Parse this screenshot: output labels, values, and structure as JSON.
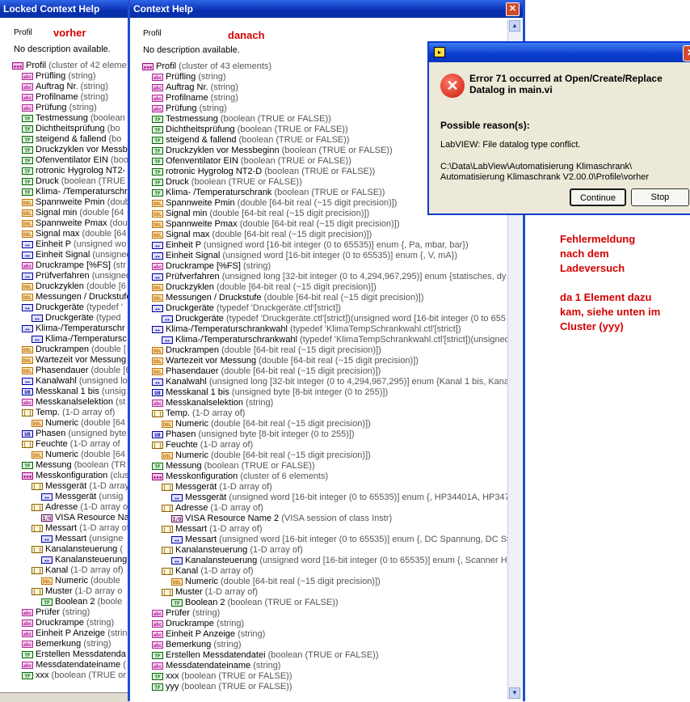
{
  "left": {
    "title": "Locked Context Help",
    "profil_label": "Profil",
    "annotation": "vorher",
    "no_desc": "No description available.",
    "rows": [
      {
        "d": 0,
        "ic": "cl",
        "n": "Profil",
        "t": "(cluster of 42 eleme"
      },
      {
        "d": 1,
        "ic": "str",
        "n": "Prüfling",
        "t": "(string)"
      },
      {
        "d": 1,
        "ic": "str",
        "n": "Auftrag Nr.",
        "t": "(string)"
      },
      {
        "d": 1,
        "ic": "str",
        "n": "Profilname",
        "t": "(string)"
      },
      {
        "d": 1,
        "ic": "str",
        "n": "Prüfung",
        "t": "(string)"
      },
      {
        "d": 1,
        "ic": "bool",
        "n": "Testmessung",
        "t": "(boolean"
      },
      {
        "d": 1,
        "ic": "bool",
        "n": "Dichtheitsprüfung",
        "t": "(bo"
      },
      {
        "d": 1,
        "ic": "bool",
        "n": "steigend & fallend",
        "t": "(bo"
      },
      {
        "d": 1,
        "ic": "bool",
        "n": "Druckzyklen vor Messb",
        "t": ""
      },
      {
        "d": 1,
        "ic": "bool",
        "n": "Ofenventilator EIN",
        "t": "(boo"
      },
      {
        "d": 1,
        "ic": "bool",
        "n": "rotronic Hygrolog NT2-",
        "t": ""
      },
      {
        "d": 1,
        "ic": "bool",
        "n": "Druck",
        "t": "(boolean (TRUE"
      },
      {
        "d": 1,
        "ic": "bool",
        "n": "Klima- /Temperaturschra",
        "t": ""
      },
      {
        "d": 1,
        "ic": "dbl",
        "n": "Spannweite Pmin",
        "t": "(double"
      },
      {
        "d": 1,
        "ic": "dbl",
        "n": "Signal min",
        "t": "(double [64"
      },
      {
        "d": 1,
        "ic": "dbl",
        "n": "Spannweite Pmax",
        "t": "(double"
      },
      {
        "d": 1,
        "ic": "dbl",
        "n": "Signal max",
        "t": "(double [64"
      },
      {
        "d": 1,
        "ic": "enum",
        "n": "Einheit P",
        "t": "(unsigned wo"
      },
      {
        "d": 1,
        "ic": "enum",
        "n": "Einheit Signal",
        "t": "(unsigned"
      },
      {
        "d": 1,
        "ic": "str",
        "n": "Druckrampe [%FS]",
        "t": "(str"
      },
      {
        "d": 1,
        "ic": "enum",
        "n": "Prüfverfahren",
        "t": "(unsigned"
      },
      {
        "d": 1,
        "ic": "dbl",
        "n": "Druckzyklen",
        "t": "(double [6"
      },
      {
        "d": 1,
        "ic": "dbl",
        "n": "Messungen / Druckstufe",
        "t": ""
      },
      {
        "d": 1,
        "ic": "enum",
        "n": "Druckgeräte",
        "t": "(typedef '"
      },
      {
        "d": 2,
        "ic": "enum",
        "n": "Druckgeräte",
        "t": "(typed"
      },
      {
        "d": 1,
        "ic": "enum",
        "n": "Klima-/Temperaturschr",
        "t": ""
      },
      {
        "d": 2,
        "ic": "enum",
        "n": "Klima-/Temperatursc",
        "t": ""
      },
      {
        "d": 1,
        "ic": "dbl",
        "n": "Druckrampen",
        "t": "(double ["
      },
      {
        "d": 1,
        "ic": "dbl",
        "n": "Wartezeit vor Messung",
        "t": ""
      },
      {
        "d": 1,
        "ic": "dbl",
        "n": "Phasendauer",
        "t": "(double [6"
      },
      {
        "d": 1,
        "ic": "enum",
        "n": "Kanalwahl",
        "t": "(unsigned lo"
      },
      {
        "d": 1,
        "ic": "u",
        "n": "Messkanal 1 bis",
        "t": "(unsig"
      },
      {
        "d": 1,
        "ic": "str",
        "n": "Messkanalselektion",
        "t": "(st"
      },
      {
        "d": 1,
        "ic": "arr",
        "n": "Temp.",
        "t": "(1-D array of)"
      },
      {
        "d": 2,
        "ic": "dbl",
        "n": "Numeric",
        "t": "(double [64"
      },
      {
        "d": 1,
        "ic": "u",
        "n": "Phasen",
        "t": "(unsigned byte"
      },
      {
        "d": 1,
        "ic": "arr",
        "n": "Feuchte",
        "t": "(1-D array of"
      },
      {
        "d": 2,
        "ic": "dbl",
        "n": "Numeric",
        "t": "(double [64"
      },
      {
        "d": 1,
        "ic": "bool",
        "n": "Messung",
        "t": "(boolean (TR"
      },
      {
        "d": 1,
        "ic": "cl",
        "n": "Messkonfiguration",
        "t": "(clus"
      },
      {
        "d": 2,
        "ic": "arr",
        "n": "Messgerät",
        "t": "(1-D array"
      },
      {
        "d": 3,
        "ic": "enum",
        "n": "Messgerät",
        "t": "(unsig"
      },
      {
        "d": 2,
        "ic": "arr",
        "n": "Adresse",
        "t": "(1-D array o"
      },
      {
        "d": 3,
        "ic": "visa",
        "n": "VISA Resource Na",
        "t": ""
      },
      {
        "d": 2,
        "ic": "arr",
        "n": "Messart",
        "t": "(1-D array of"
      },
      {
        "d": 3,
        "ic": "enum",
        "n": "Messart",
        "t": "(unsigne"
      },
      {
        "d": 2,
        "ic": "arr",
        "n": "Kanalansteuerung",
        "t": "("
      },
      {
        "d": 3,
        "ic": "enum",
        "n": "Kanalansteuerung",
        "t": ""
      },
      {
        "d": 2,
        "ic": "arr",
        "n": "Kanal",
        "t": "(1-D array of)"
      },
      {
        "d": 3,
        "ic": "dbl",
        "n": "Numeric",
        "t": "(double"
      },
      {
        "d": 2,
        "ic": "arr",
        "n": "Muster",
        "t": "(1-D array o"
      },
      {
        "d": 3,
        "ic": "bool",
        "n": "Boolean 2",
        "t": "(boole"
      },
      {
        "d": 1,
        "ic": "str",
        "n": "Prüfer",
        "t": "(string)"
      },
      {
        "d": 1,
        "ic": "str",
        "n": "Druckrampe",
        "t": "(string)"
      },
      {
        "d": 1,
        "ic": "str",
        "n": "Einheit P Anzeige",
        "t": "(strin"
      },
      {
        "d": 1,
        "ic": "str",
        "n": "Bemerkung",
        "t": "(string)"
      },
      {
        "d": 1,
        "ic": "bool",
        "n": "Erstellen Messdatenda",
        "t": ""
      },
      {
        "d": 1,
        "ic": "str",
        "n": "Messdatendateiname",
        "t": "("
      },
      {
        "d": 1,
        "ic": "bool",
        "n": "xxx",
        "t": "(boolean (TRUE or"
      }
    ]
  },
  "right": {
    "title": "Context Help",
    "close": "✕",
    "profil_label": "Profil",
    "annotation": "danach",
    "no_desc": "No description available.",
    "rows": [
      {
        "d": 0,
        "ic": "cl",
        "n": "Profil",
        "t": "(cluster of 43 elements)"
      },
      {
        "d": 1,
        "ic": "str",
        "n": "Prüfling",
        "t": "(string)"
      },
      {
        "d": 1,
        "ic": "str",
        "n": "Auftrag Nr.",
        "t": "(string)"
      },
      {
        "d": 1,
        "ic": "str",
        "n": "Profilname",
        "t": "(string)"
      },
      {
        "d": 1,
        "ic": "str",
        "n": "Prüfung",
        "t": "(string)"
      },
      {
        "d": 1,
        "ic": "bool",
        "n": "Testmessung",
        "t": "(boolean (TRUE or FALSE))"
      },
      {
        "d": 1,
        "ic": "bool",
        "n": "Dichtheitsprüfung",
        "t": "(boolean (TRUE or FALSE))"
      },
      {
        "d": 1,
        "ic": "bool",
        "n": "steigend & fallend",
        "t": "(boolean (TRUE or FALSE))"
      },
      {
        "d": 1,
        "ic": "bool",
        "n": "Druckzyklen vor Messbeginn",
        "t": "(boolean (TRUE or FALSE))"
      },
      {
        "d": 1,
        "ic": "bool",
        "n": "Ofenventilator EIN",
        "t": "(boolean (TRUE or FALSE))"
      },
      {
        "d": 1,
        "ic": "bool",
        "n": "rotronic Hygrolog NT2-D",
        "t": "(boolean (TRUE or FALSE))"
      },
      {
        "d": 1,
        "ic": "bool",
        "n": "Druck",
        "t": "(boolean (TRUE or FALSE))"
      },
      {
        "d": 1,
        "ic": "bool",
        "n": "Klima- /Temperaturschrank",
        "t": "(boolean (TRUE or FALSE))"
      },
      {
        "d": 1,
        "ic": "dbl",
        "n": "Spannweite Pmin",
        "t": "(double [64-bit real (~15 digit precision)])"
      },
      {
        "d": 1,
        "ic": "dbl",
        "n": "Signal min",
        "t": "(double [64-bit real (~15 digit precision)])"
      },
      {
        "d": 1,
        "ic": "dbl",
        "n": "Spannweite Pmax",
        "t": "(double [64-bit real (~15 digit precision)])"
      },
      {
        "d": 1,
        "ic": "dbl",
        "n": "Signal max",
        "t": "(double [64-bit real (~15 digit precision)])"
      },
      {
        "d": 1,
        "ic": "enum",
        "n": "Einheit P",
        "t": "(unsigned word [16-bit integer (0 to 65535)] enum {, Pa, mbar, bar})"
      },
      {
        "d": 1,
        "ic": "enum",
        "n": "Einheit Signal",
        "t": "(unsigned word [16-bit integer (0 to 65535)] enum {, V, mA})"
      },
      {
        "d": 1,
        "ic": "str",
        "n": "Druckrampe [%FS]",
        "t": "(string)"
      },
      {
        "d": 1,
        "ic": "enum",
        "n": "Prüfverfahren",
        "t": "(unsigned long [32-bit integer (0 to 4,294,967,295)] enum {statisches, dy"
      },
      {
        "d": 1,
        "ic": "dbl",
        "n": "Druckzyklen",
        "t": "(double [64-bit real (~15 digit precision)])"
      },
      {
        "d": 1,
        "ic": "dbl",
        "n": "Messungen / Druckstufe",
        "t": "(double [64-bit real (~15 digit precision)])"
      },
      {
        "d": 1,
        "ic": "enum",
        "n": "Druckgeräte",
        "t": "(typedef 'Druckgeräte.ctl'[strict])"
      },
      {
        "d": 2,
        "ic": "enum",
        "n": "Druckgeräte",
        "t": "(typedef 'Druckgeräte.ctl'[strict])(unsigned word [16-bit integer (0 to 655"
      },
      {
        "d": 1,
        "ic": "enum",
        "n": "Klima-/Temperaturschrankwahl",
        "t": "(typedef 'KlimaTempSchrankwahl.ctl'[strict])"
      },
      {
        "d": 2,
        "ic": "enum",
        "n": "Klima-/Temperaturschrankwahl",
        "t": "(typedef 'KlimaTempSchrankwahl.ctl'[strict])(unsigned"
      },
      {
        "d": 1,
        "ic": "dbl",
        "n": "Druckrampen",
        "t": "(double [64-bit real (~15 digit precision)])"
      },
      {
        "d": 1,
        "ic": "dbl",
        "n": "Wartezeit vor Messung",
        "t": "(double [64-bit real (~15 digit precision)])"
      },
      {
        "d": 1,
        "ic": "dbl",
        "n": "Phasendauer",
        "t": "(double [64-bit real (~15 digit precision)])"
      },
      {
        "d": 1,
        "ic": "enum",
        "n": "Kanalwahl",
        "t": "(unsigned long [32-bit integer (0 to 4,294,967,295)] enum {Kanal 1 bis, Kanal"
      },
      {
        "d": 1,
        "ic": "u",
        "n": "Messkanal 1 bis",
        "t": "(unsigned byte [8-bit integer (0 to 255)])"
      },
      {
        "d": 1,
        "ic": "str",
        "n": "Messkanalselektion",
        "t": "(string)"
      },
      {
        "d": 1,
        "ic": "arr",
        "n": "Temp.",
        "t": "(1-D array of)"
      },
      {
        "d": 2,
        "ic": "dbl",
        "n": "Numeric",
        "t": "(double [64-bit real (~15 digit precision)])"
      },
      {
        "d": 1,
        "ic": "u",
        "n": "Phasen",
        "t": "(unsigned byte [8-bit integer (0 to 255)])"
      },
      {
        "d": 1,
        "ic": "arr",
        "n": "Feuchte",
        "t": "(1-D array of)"
      },
      {
        "d": 2,
        "ic": "dbl",
        "n": "Numeric",
        "t": "(double [64-bit real (~15 digit precision)])"
      },
      {
        "d": 1,
        "ic": "bool",
        "n": "Messung",
        "t": "(boolean (TRUE or FALSE))"
      },
      {
        "d": 1,
        "ic": "cl",
        "n": "Messkonfiguration",
        "t": "(cluster of 6 elements)"
      },
      {
        "d": 2,
        "ic": "arr",
        "n": "Messgerät",
        "t": "(1-D array of)"
      },
      {
        "d": 3,
        "ic": "enum",
        "n": "Messgerät",
        "t": "(unsigned word [16-bit integer (0 to 65535)] enum {, HP34401A, HP347"
      },
      {
        "d": 2,
        "ic": "arr",
        "n": "Adresse",
        "t": "(1-D array of)"
      },
      {
        "d": 3,
        "ic": "visa",
        "n": "VISA Resource Name 2",
        "t": "(VISA session of class Instr)"
      },
      {
        "d": 2,
        "ic": "arr",
        "n": "Messart",
        "t": "(1-D array of)"
      },
      {
        "d": 3,
        "ic": "enum",
        "n": "Messart",
        "t": "(unsigned word [16-bit integer (0 to 65535)] enum {, DC Spannung, DC Str"
      },
      {
        "d": 2,
        "ic": "arr",
        "n": "Kanalansteuerung",
        "t": "(1-D array of)"
      },
      {
        "d": 3,
        "ic": "enum",
        "n": "Kanalansteuerung",
        "t": "(unsigned word [16-bit integer (0 to 65535)] enum {, Scanner HP"
      },
      {
        "d": 2,
        "ic": "arr",
        "n": "Kanal",
        "t": "(1-D array of)"
      },
      {
        "d": 3,
        "ic": "dbl",
        "n": "Numeric",
        "t": "(double [64-bit real (~15 digit precision)])"
      },
      {
        "d": 2,
        "ic": "arr",
        "n": "Muster",
        "t": "(1-D array of)"
      },
      {
        "d": 3,
        "ic": "bool",
        "n": "Boolean 2",
        "t": "(boolean (TRUE or FALSE))"
      },
      {
        "d": 1,
        "ic": "str",
        "n": "Prüfer",
        "t": "(string)"
      },
      {
        "d": 1,
        "ic": "str",
        "n": "Druckrampe",
        "t": "(string)"
      },
      {
        "d": 1,
        "ic": "str",
        "n": "Einheit P Anzeige",
        "t": "(string)"
      },
      {
        "d": 1,
        "ic": "str",
        "n": "Bemerkung",
        "t": "(string)"
      },
      {
        "d": 1,
        "ic": "bool",
        "n": "Erstellen Messdatendatei",
        "t": "(boolean (TRUE or FALSE))"
      },
      {
        "d": 1,
        "ic": "str",
        "n": "Messdatendateiname",
        "t": "(string)"
      },
      {
        "d": 1,
        "ic": "bool",
        "n": "xxx",
        "t": "(boolean (TRUE or FALSE))"
      },
      {
        "d": 1,
        "ic": "bool",
        "n": "yyy",
        "t": "(boolean (TRUE or FALSE))"
      }
    ]
  },
  "icon_labels": {
    "str": "abc",
    "bool": "TF",
    "dbl": "DBL",
    "enum": "◂▸",
    "u": "U8",
    "arr": "[ ]",
    "cl": "▪▪▪",
    "visa": "I/O"
  },
  "error": {
    "message": "Error 71 occurred at Open/Create/Replace Datalog in main.vi",
    "reasons_label": "Possible reason(s):",
    "reason": "LabVIEW:  File datalog type conflict.",
    "path_line1": "C:\\Data\\LabView\\Automatisierung Klimaschrank\\",
    "path_line2": "Automatisierung Klimaschrank V2.00.0\\Profile\\vorher",
    "continue_label": "Continue",
    "stop_label": "Stop",
    "close": "✕",
    "icon": "✕"
  },
  "note": {
    "lines": [
      "Fehlermeldung",
      "nach dem",
      "Ladeversuch",
      "",
      "da 1 Element dazu",
      "kam, siehe unten im",
      "Cluster (yyy)"
    ]
  }
}
